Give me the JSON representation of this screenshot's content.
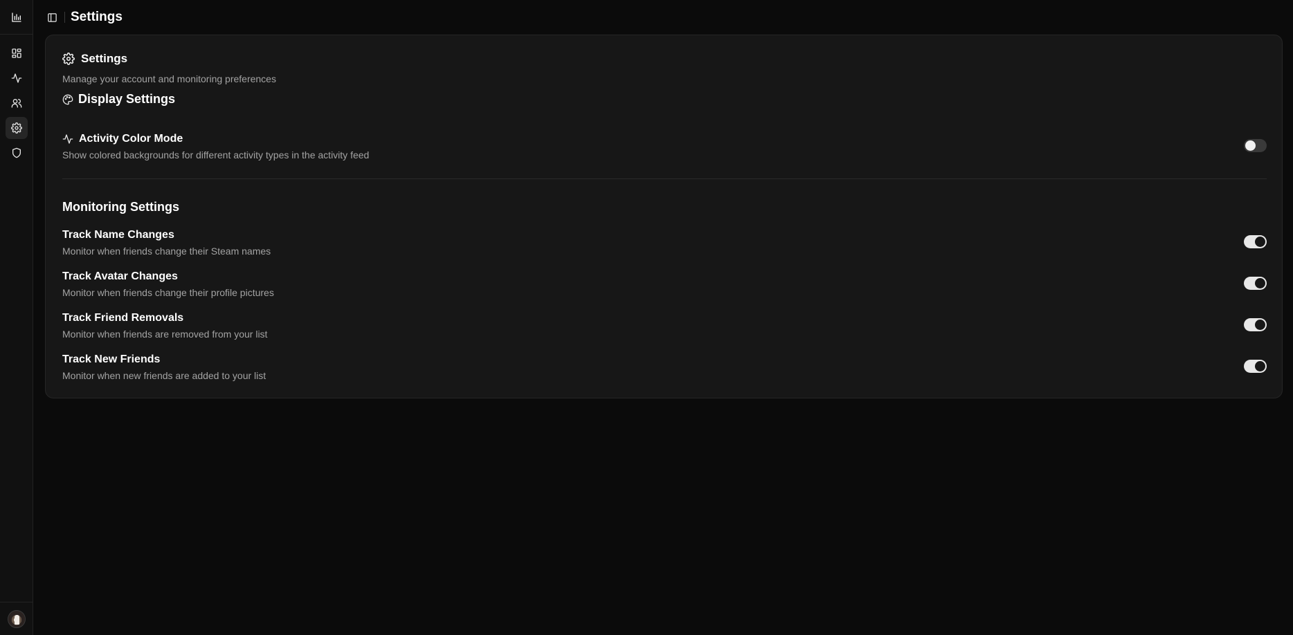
{
  "sidebar": {
    "top_icon": "bar-chart-icon",
    "items": [
      {
        "icon": "dashboard-icon",
        "active": false
      },
      {
        "icon": "activity-icon",
        "active": false
      },
      {
        "icon": "users-icon",
        "active": false
      },
      {
        "icon": "gear-icon",
        "active": true
      },
      {
        "icon": "shield-icon",
        "active": false
      }
    ],
    "avatar": "user-avatar"
  },
  "header": {
    "toggle_icon": "sidebar-toggle-icon",
    "title": "Settings"
  },
  "card": {
    "title": "Settings",
    "subtitle": "Manage your account and monitoring preferences"
  },
  "display": {
    "title": "Display Settings",
    "settings": [
      {
        "label": "Activity Color Mode",
        "description": "Show colored backgrounds for different activity types in the activity feed",
        "enabled": false
      }
    ]
  },
  "monitoring": {
    "title": "Monitoring Settings",
    "settings": [
      {
        "label": "Track Name Changes",
        "description": "Monitor when friends change their Steam names",
        "enabled": true
      },
      {
        "label": "Track Avatar Changes",
        "description": "Monitor when friends change their profile pictures",
        "enabled": true
      },
      {
        "label": "Track Friend Removals",
        "description": "Monitor when friends are removed from your list",
        "enabled": true
      },
      {
        "label": "Track New Friends",
        "description": "Monitor when new friends are added to your list",
        "enabled": true
      }
    ]
  },
  "colors": {
    "background": "#0b0b0b",
    "card": "#171717",
    "switch_on": "#e8e8e8",
    "switch_off": "#3a3a3a"
  }
}
